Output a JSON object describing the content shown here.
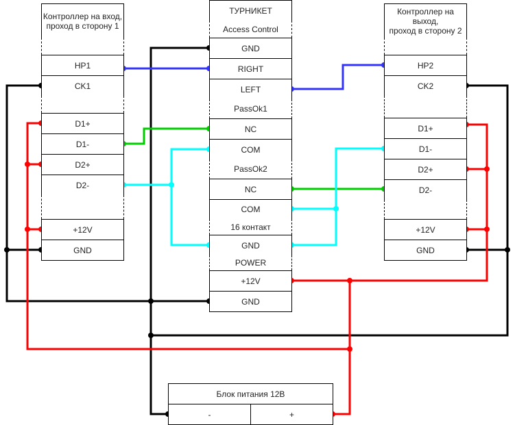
{
  "left_controller": {
    "title": "Контроллер на вход, проход в сторону 1",
    "pins": [
      "HP1",
      "CK1",
      "D1+",
      "D1-",
      "D2+",
      "D2-",
      "+12V",
      "GND"
    ]
  },
  "turnstile": {
    "title": "ТУРНИКЕТ",
    "subtitle": "Access Control",
    "pins": [
      "GND",
      "RIGHT",
      "LEFT",
      "NC",
      "COM",
      "NC",
      "COM",
      "GND",
      "+12V",
      "GND"
    ],
    "groups": [
      "PassOk1",
      "PassOk2",
      "16 контакт",
      "POWER"
    ]
  },
  "right_controller": {
    "title": "Контроллер на выход,\nпроход в сторону 2",
    "pins": [
      "HP2",
      "CK2",
      "D1+",
      "D1-",
      "D2+",
      "D2-",
      "+12V",
      "GND"
    ]
  },
  "power_supply": {
    "title": "Блок питания 12В",
    "minus": "-",
    "plus": "+"
  },
  "colors": {
    "ground": "#000000",
    "hp": "#3333ff",
    "green": "#00cc00",
    "cyan": "#00ffff",
    "power": "#ff0000"
  }
}
